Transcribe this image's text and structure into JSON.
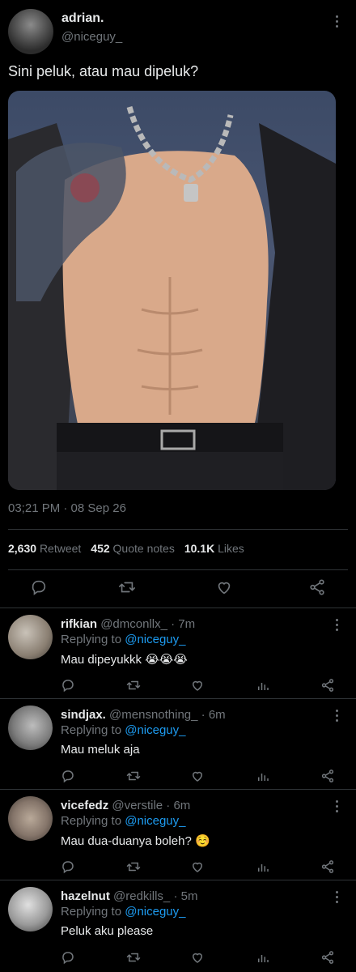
{
  "post": {
    "display_name": "adrian.",
    "handle": "@niceguy_",
    "text": "Sini peluk, atau mau dipeluk?",
    "timestamp": "03;21 PM · 08 Sep 26",
    "stats": {
      "retweets_count": "2,630",
      "retweets_label": "Retweet",
      "quotes_count": "452",
      "quotes_label": "Quote notes",
      "likes_count": "10.1K",
      "likes_label": "Likes"
    }
  },
  "replies": [
    {
      "name": "rifkian",
      "handle": "@dmconllx_",
      "time": "· 7m",
      "replying_prefix": "Replying to",
      "replying_to": "@niceguy_",
      "text": "Mau dipeyukkk 😭😭😭"
    },
    {
      "name": "sindjax.",
      "handle": "@mensnothing_",
      "time": "· 6m",
      "replying_prefix": "Replying to",
      "replying_to": "@niceguy_",
      "text": "Mau meluk aja"
    },
    {
      "name": "vicefedz",
      "handle": "@verstile",
      "time": "· 6m",
      "replying_prefix": "Replying to",
      "replying_to": "@niceguy_",
      "text": "Mau dua-duanya boleh? ☺️"
    },
    {
      "name": "hazelnut",
      "handle": "@redkills_",
      "time": "· 5m",
      "replying_prefix": "Replying to",
      "replying_to": "@niceguy_",
      "text": "Peluk aku please"
    }
  ],
  "colors": {
    "background": "#000000",
    "text": "#e7e9ea",
    "muted": "#71767b",
    "link": "#1d9bf0",
    "divider": "#2f3336"
  },
  "icons": [
    "more-icon",
    "reply-icon",
    "retweet-icon",
    "like-icon",
    "share-icon",
    "analytics-icon"
  ]
}
